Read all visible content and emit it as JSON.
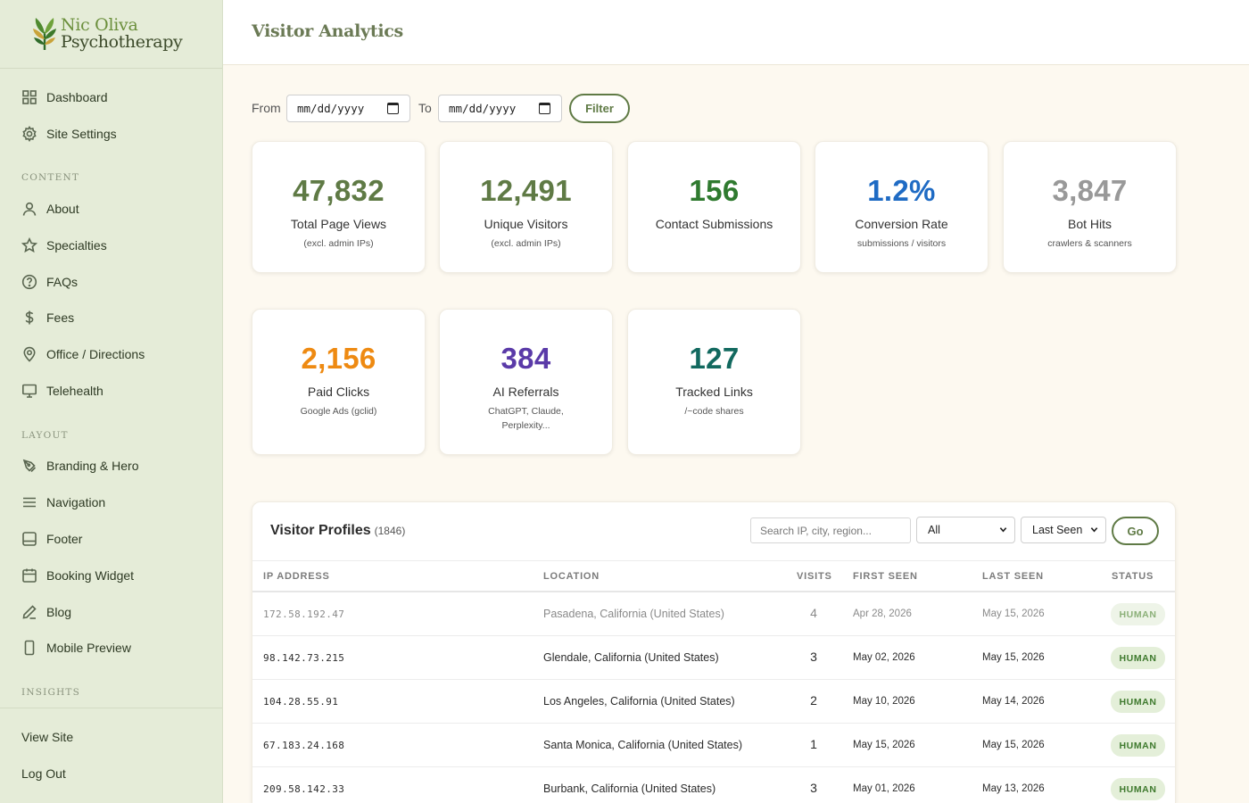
{
  "brand": {
    "line1": "Nic Oliva",
    "line2": "Psychotherapy"
  },
  "sidebar": {
    "main": [
      {
        "label": "Dashboard",
        "icon": "grid-icon"
      },
      {
        "label": "Site Settings",
        "icon": "gear-icon"
      }
    ],
    "content_label": "CONTENT",
    "content": [
      {
        "label": "About",
        "icon": "user-icon"
      },
      {
        "label": "Specialties",
        "icon": "star-icon"
      },
      {
        "label": "FAQs",
        "icon": "question-icon"
      },
      {
        "label": "Fees",
        "icon": "dollar-icon"
      },
      {
        "label": "Office / Directions",
        "icon": "map-pin-icon"
      },
      {
        "label": "Telehealth",
        "icon": "monitor-icon"
      }
    ],
    "layout_label": "LAYOUT",
    "layout": [
      {
        "label": "Branding & Hero",
        "icon": "pen-tool-icon"
      },
      {
        "label": "Navigation",
        "icon": "menu-icon"
      },
      {
        "label": "Footer",
        "icon": "footer-icon"
      },
      {
        "label": "Booking Widget",
        "icon": "calendar-icon"
      },
      {
        "label": "Blog",
        "icon": "edit-icon"
      },
      {
        "label": "Mobile Preview",
        "icon": "phone-icon"
      }
    ],
    "insights_label": "INSIGHTS",
    "bottom": [
      {
        "label": "View Site"
      },
      {
        "label": "Log Out"
      }
    ]
  },
  "header": {
    "title": "Visitor Analytics"
  },
  "filter": {
    "from_label": "From",
    "to_label": "To",
    "from_placeholder": "mm/dd/yyyy",
    "to_placeholder": "mm/dd/yyyy",
    "button": "Filter"
  },
  "stats": [
    {
      "value": "47,832",
      "label": "Total Page Views",
      "sub": "(excl. admin IPs)",
      "color": "#5f7a45"
    },
    {
      "value": "12,491",
      "label": "Unique Visitors",
      "sub": "(excl. admin IPs)",
      "color": "#5f7a45"
    },
    {
      "value": "156",
      "label": "Contact Submissions",
      "sub": "",
      "color": "#2f7a2f"
    },
    {
      "value": "1.2%",
      "label": "Conversion Rate",
      "sub": "submissions / visitors",
      "color": "#1f6bc4"
    },
    {
      "value": "3,847",
      "label": "Bot Hits",
      "sub": "crawlers & scanners",
      "color": "#999999"
    },
    {
      "value": "2,156",
      "label": "Paid Clicks",
      "sub": "Google Ads (gclid)",
      "color": "#ee8a12"
    },
    {
      "value": "384",
      "label": "AI Referrals",
      "sub": "ChatGPT, Claude, Perplexity...",
      "color": "#5a3aa8"
    },
    {
      "value": "127",
      "label": "Tracked Links",
      "sub": "/~code shares",
      "color": "#12695f"
    }
  ],
  "profiles": {
    "title": "Visitor Profiles",
    "count": "(1846)",
    "search_placeholder": "Search IP, city, region...",
    "filter_value": "All",
    "sort_value": "Last Seen",
    "go_label": "Go",
    "columns": [
      "IP ADDRESS",
      "LOCATION",
      "VISITS",
      "FIRST SEEN",
      "LAST SEEN",
      "STATUS"
    ],
    "rows": [
      {
        "ip": "172.58.192.47",
        "location": "Pasadena, California (United States)",
        "visits": "4",
        "first": "Apr 28, 2026",
        "last": "May 15, 2026",
        "status": "HUMAN"
      },
      {
        "ip": "98.142.73.215",
        "location": "Glendale, California (United States)",
        "visits": "3",
        "first": "May 02, 2026",
        "last": "May 15, 2026",
        "status": "HUMAN"
      },
      {
        "ip": "104.28.55.91",
        "location": "Los Angeles, California (United States)",
        "visits": "2",
        "first": "May 10, 2026",
        "last": "May 14, 2026",
        "status": "HUMAN"
      },
      {
        "ip": "67.183.24.168",
        "location": "Santa Monica, California (United States)",
        "visits": "1",
        "first": "May 15, 2026",
        "last": "May 15, 2026",
        "status": "HUMAN"
      },
      {
        "ip": "209.58.142.33",
        "location": "Burbank, California (United States)",
        "visits": "3",
        "first": "May 01, 2026",
        "last": "May 13, 2026",
        "status": "HUMAN"
      }
    ]
  }
}
